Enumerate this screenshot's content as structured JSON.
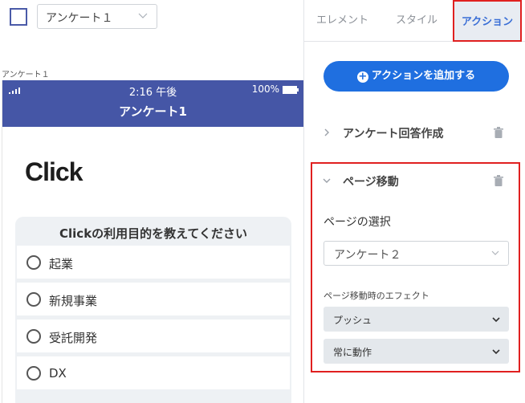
{
  "toolbar": {
    "page_select_value": "アンケート１"
  },
  "canvas": {
    "frame_label": "アンケート１"
  },
  "phone": {
    "status_time": "2:16 午後",
    "battery_percent": "100%",
    "header_title": "アンケート1",
    "logo_text": "Click",
    "question": {
      "title": "Clickの利用目的を教えてください",
      "options": [
        "起業",
        "新規事業",
        "受託開発",
        "DX"
      ]
    }
  },
  "panel": {
    "tabs": [
      {
        "label": "エレメント",
        "active": false
      },
      {
        "label": "スタイル",
        "active": false
      },
      {
        "label": "アクション",
        "active": true
      }
    ],
    "add_action_label": "アクションを追加する",
    "actions": [
      {
        "title": "アンケート回答作成",
        "expanded": false
      },
      {
        "title": "ページ移動",
        "expanded": true,
        "page_select_label": "ページの選択",
        "page_select_value": "アンケート２",
        "effect_label": "ページ移動時のエフェクト",
        "effect_value": "プッシュ",
        "trigger_value": "常に動作"
      }
    ]
  },
  "colors": {
    "header_blue": "#4556a6",
    "accent_blue": "#1f6fe0",
    "highlight_red": "#e02020",
    "tab_active_text": "#3b6fd6"
  }
}
